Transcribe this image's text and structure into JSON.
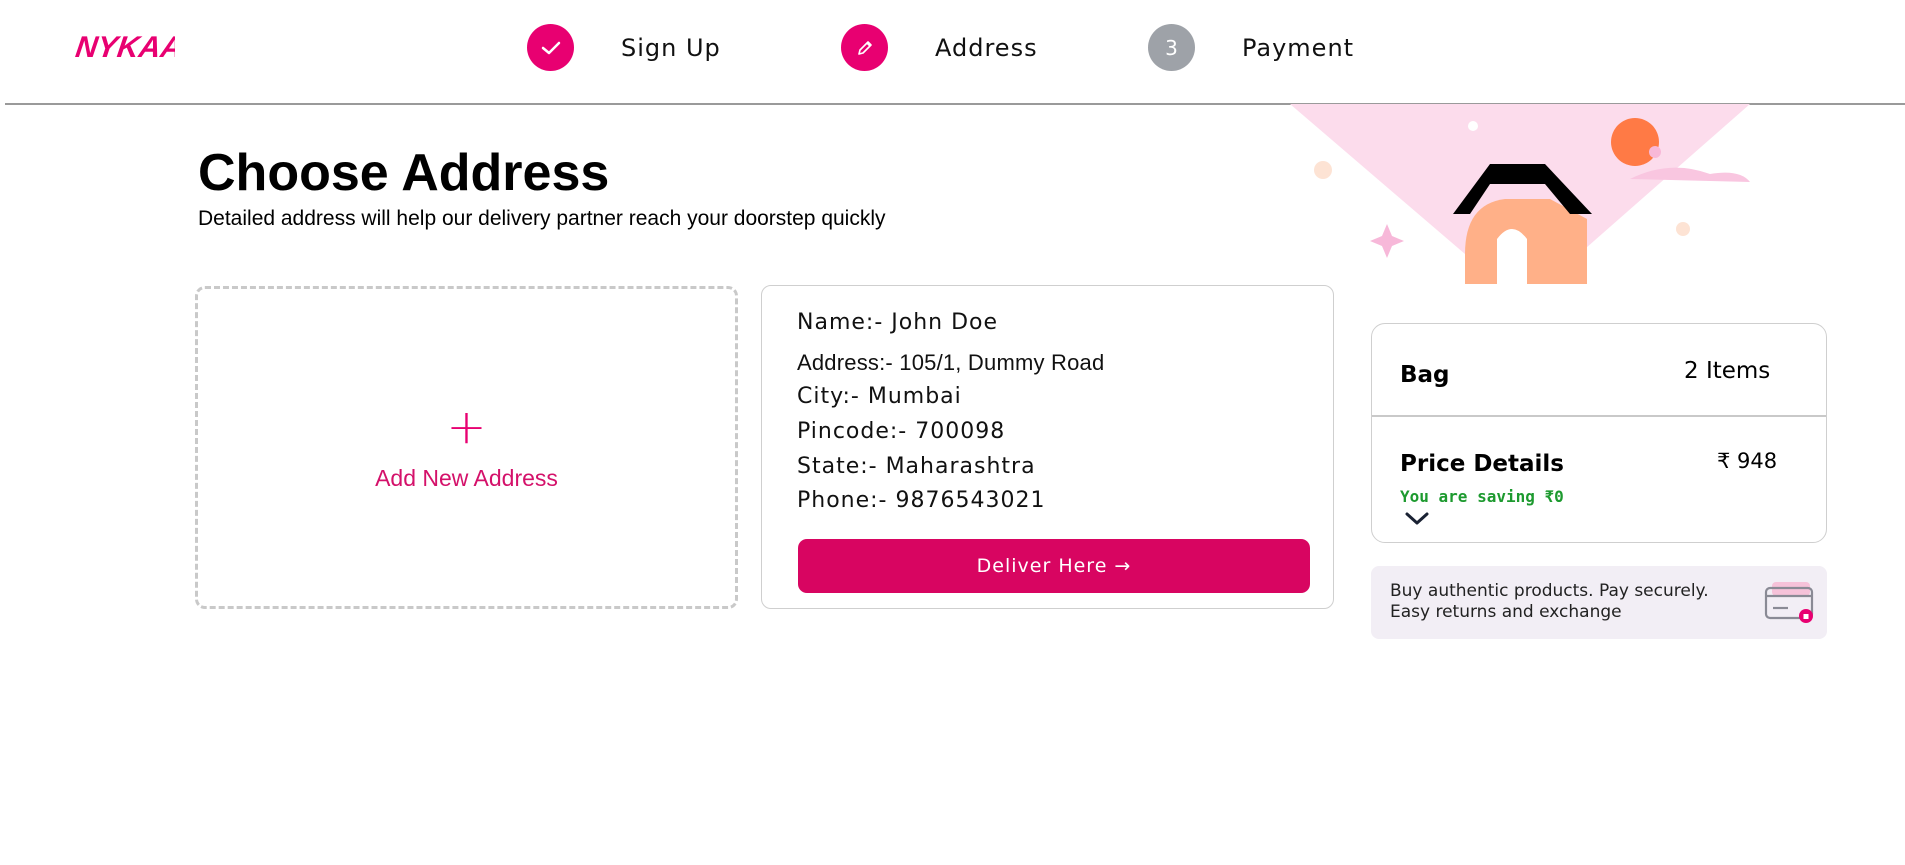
{
  "header": {
    "brand": "NYKAA",
    "steps": [
      {
        "number": "",
        "label": "Sign Up",
        "status": "completed",
        "icon": "check-icon"
      },
      {
        "number": "",
        "label": "Address",
        "status": "active",
        "icon": "pencil-icon"
      },
      {
        "number": "3",
        "label": "Payment",
        "status": "pending",
        "icon": ""
      }
    ]
  },
  "main": {
    "title": "Choose Address",
    "subtitle": "Detailed address will help our delivery partner reach your doorstep quickly",
    "add_address_label": "Add New Address",
    "add_icon": "+",
    "address": {
      "name": "Name:- John Doe",
      "address": "Address:- 105/1, Dummy Road",
      "city": "City:- Mumbai",
      "pincode": "Pincode:- 700098",
      "state": "State:- Maharashtra",
      "phone": "Phone:- 9876543021"
    },
    "deliver_button": "Deliver Here →"
  },
  "summary": {
    "bag_label": "Bag",
    "bag_count": "2 Items",
    "price_details_label": "Price Details",
    "price_amount": "₹ 948",
    "saving_text": "You are saving ₹0"
  },
  "trust": {
    "line1": "Buy authentic products. Pay securely.",
    "line2": "Easy returns and exchange"
  },
  "colors": {
    "brand_pink": "#e80071",
    "button_pink": "#d80561",
    "saving_green": "#1d9a2f",
    "pending_grey": "#9ea2a8"
  }
}
